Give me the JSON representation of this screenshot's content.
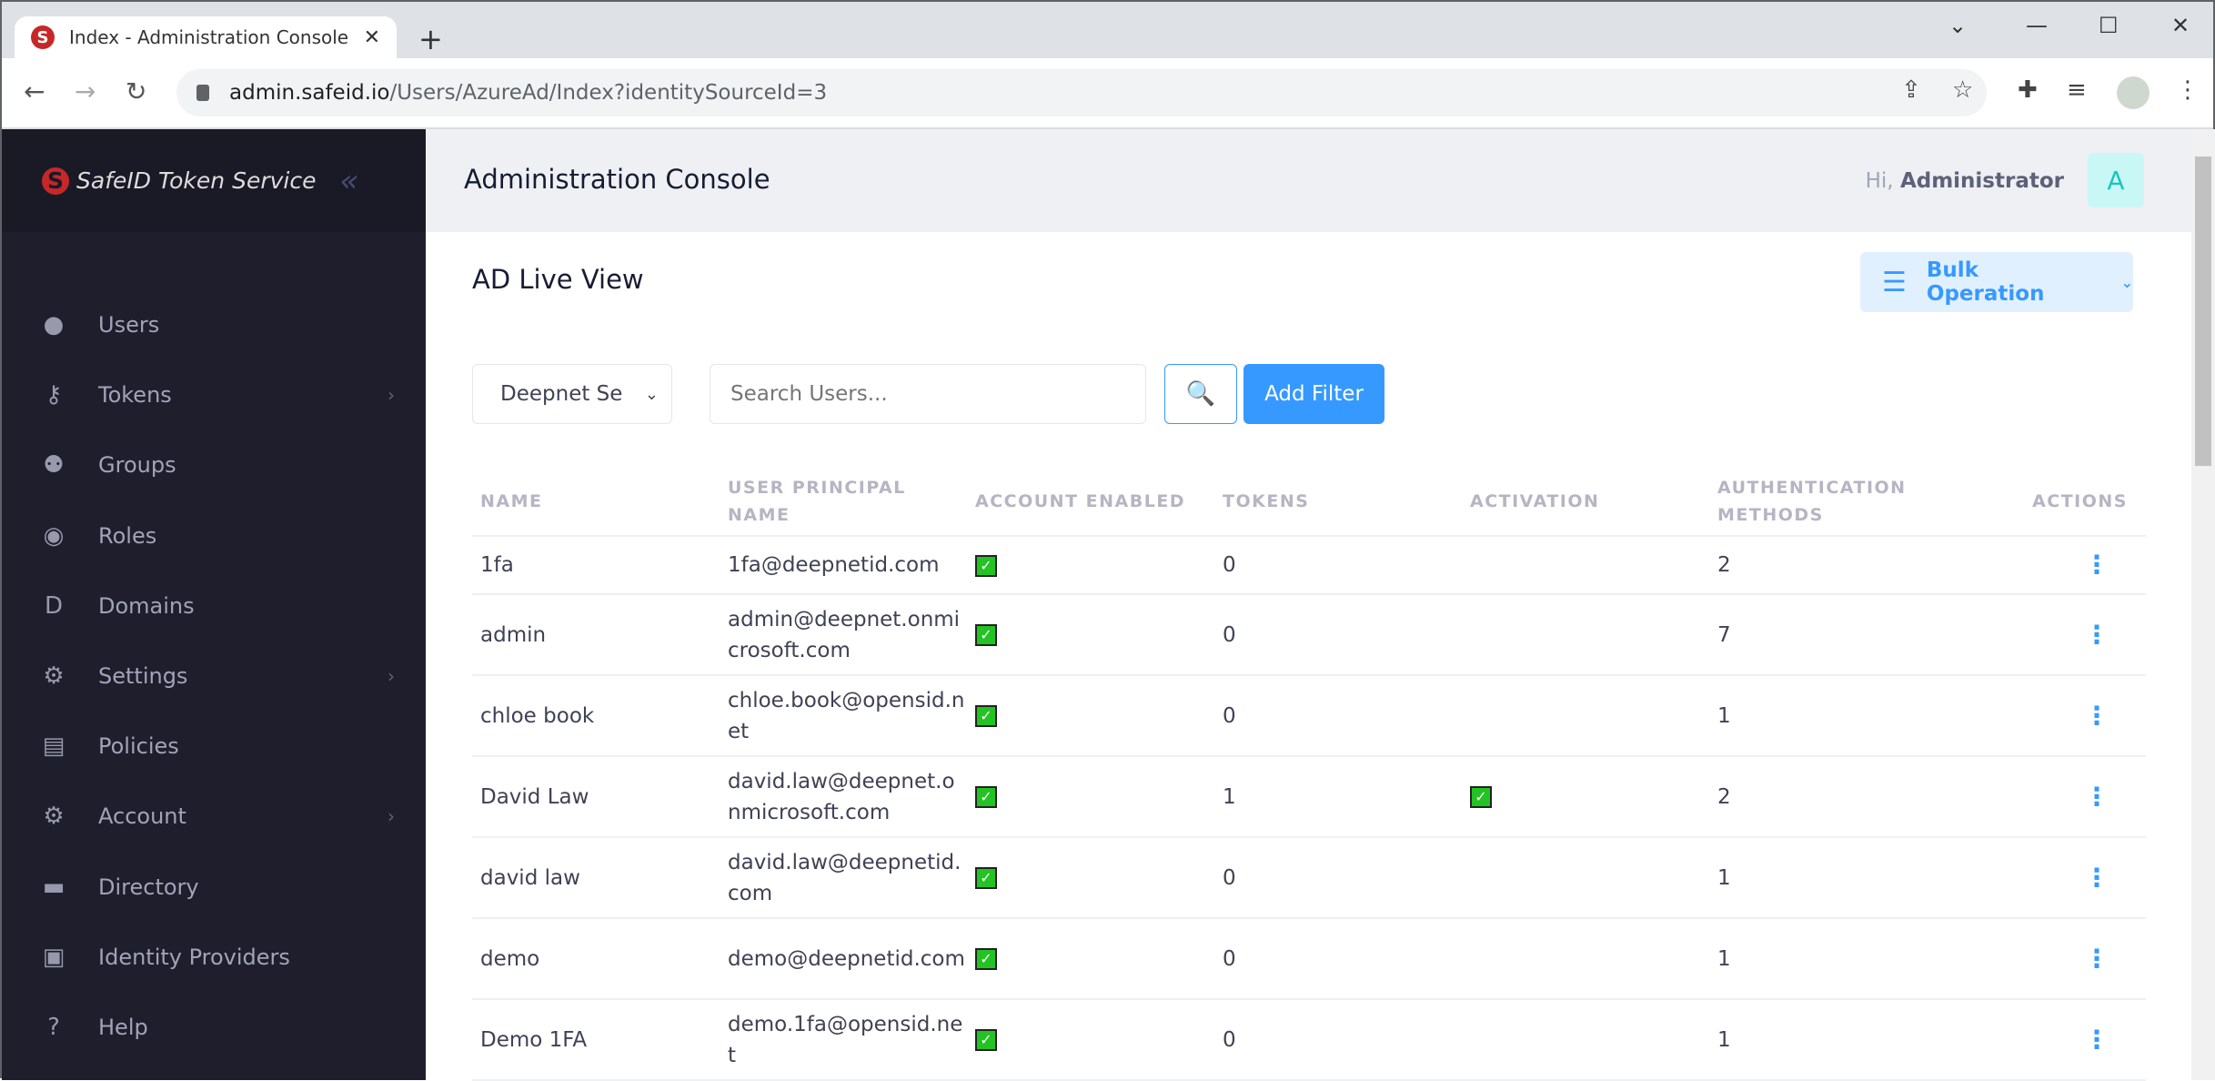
{
  "browser": {
    "tab_title": "Index - Administration Console",
    "url_host": "admin.safeid.io",
    "url_path": "/Users/AzureAd/Index?identitySourceId=3"
  },
  "sidebar": {
    "brand": "SafeID Token Service",
    "items": [
      {
        "label": "Users",
        "icon": "user-icon",
        "chevron": false
      },
      {
        "label": "Tokens",
        "icon": "key-icon",
        "chevron": true
      },
      {
        "label": "Groups",
        "icon": "users-icon",
        "chevron": false
      },
      {
        "label": "Roles",
        "icon": "user-circle-icon",
        "chevron": false
      },
      {
        "label": "Domains",
        "icon": "domain-icon",
        "chevron": false
      },
      {
        "label": "Settings",
        "icon": "gears-icon",
        "chevron": true
      },
      {
        "label": "Policies",
        "icon": "file-icon",
        "chevron": false
      },
      {
        "label": "Account",
        "icon": "user-gear-icon",
        "chevron": true
      },
      {
        "label": "Directory",
        "icon": "folder-icon",
        "chevron": false
      },
      {
        "label": "Identity Providers",
        "icon": "id-badge-icon",
        "chevron": false
      },
      {
        "label": "Help",
        "icon": "question-icon",
        "chevron": false
      }
    ]
  },
  "header": {
    "title": "Administration Console",
    "greeting": "Hi,",
    "user": "Administrator",
    "avatar": "A"
  },
  "page": {
    "title": "AD Live View",
    "bulk": "Bulk Operation",
    "source_select": "Deepnet Se",
    "search_placeholder": "Search Users...",
    "add_filter": "Add Filter"
  },
  "table": {
    "columns": [
      "NAME",
      "USER PRINCIPAL NAME",
      "ACCOUNT ENABLED",
      "TOKENS",
      "ACTIVATION",
      "AUTHENTICATION METHODS",
      "ACTIONS"
    ],
    "rows": [
      {
        "name": "1fa",
        "upn": "1fa@deepnetid.com",
        "enabled": true,
        "tokens": "0",
        "activation": false,
        "auth": "2"
      },
      {
        "name": "admin",
        "upn": "admin@deepnet.onmicrosoft.com",
        "enabled": true,
        "tokens": "0",
        "activation": false,
        "auth": "7"
      },
      {
        "name": "chloe book",
        "upn": "chloe.book@opensid.net",
        "enabled": true,
        "tokens": "0",
        "activation": false,
        "auth": "1"
      },
      {
        "name": "David Law",
        "upn": "david.law@deepnet.onmicrosoft.com",
        "enabled": true,
        "tokens": "1",
        "activation": true,
        "auth": "2"
      },
      {
        "name": "david law",
        "upn": "david.law@deepnetid.com",
        "enabled": true,
        "tokens": "0",
        "activation": false,
        "auth": "1"
      },
      {
        "name": "demo",
        "upn": "demo@deepnetid.com",
        "enabled": true,
        "tokens": "0",
        "activation": false,
        "auth": "1"
      },
      {
        "name": "Demo 1FA",
        "upn": "demo.1fa@opensid.net",
        "enabled": true,
        "tokens": "0",
        "activation": false,
        "auth": "1"
      }
    ]
  },
  "colors": {
    "accent": "#3699ff",
    "sidebar": "#1e1e2d",
    "check": "#22c322",
    "brand_red": "#c62828"
  }
}
